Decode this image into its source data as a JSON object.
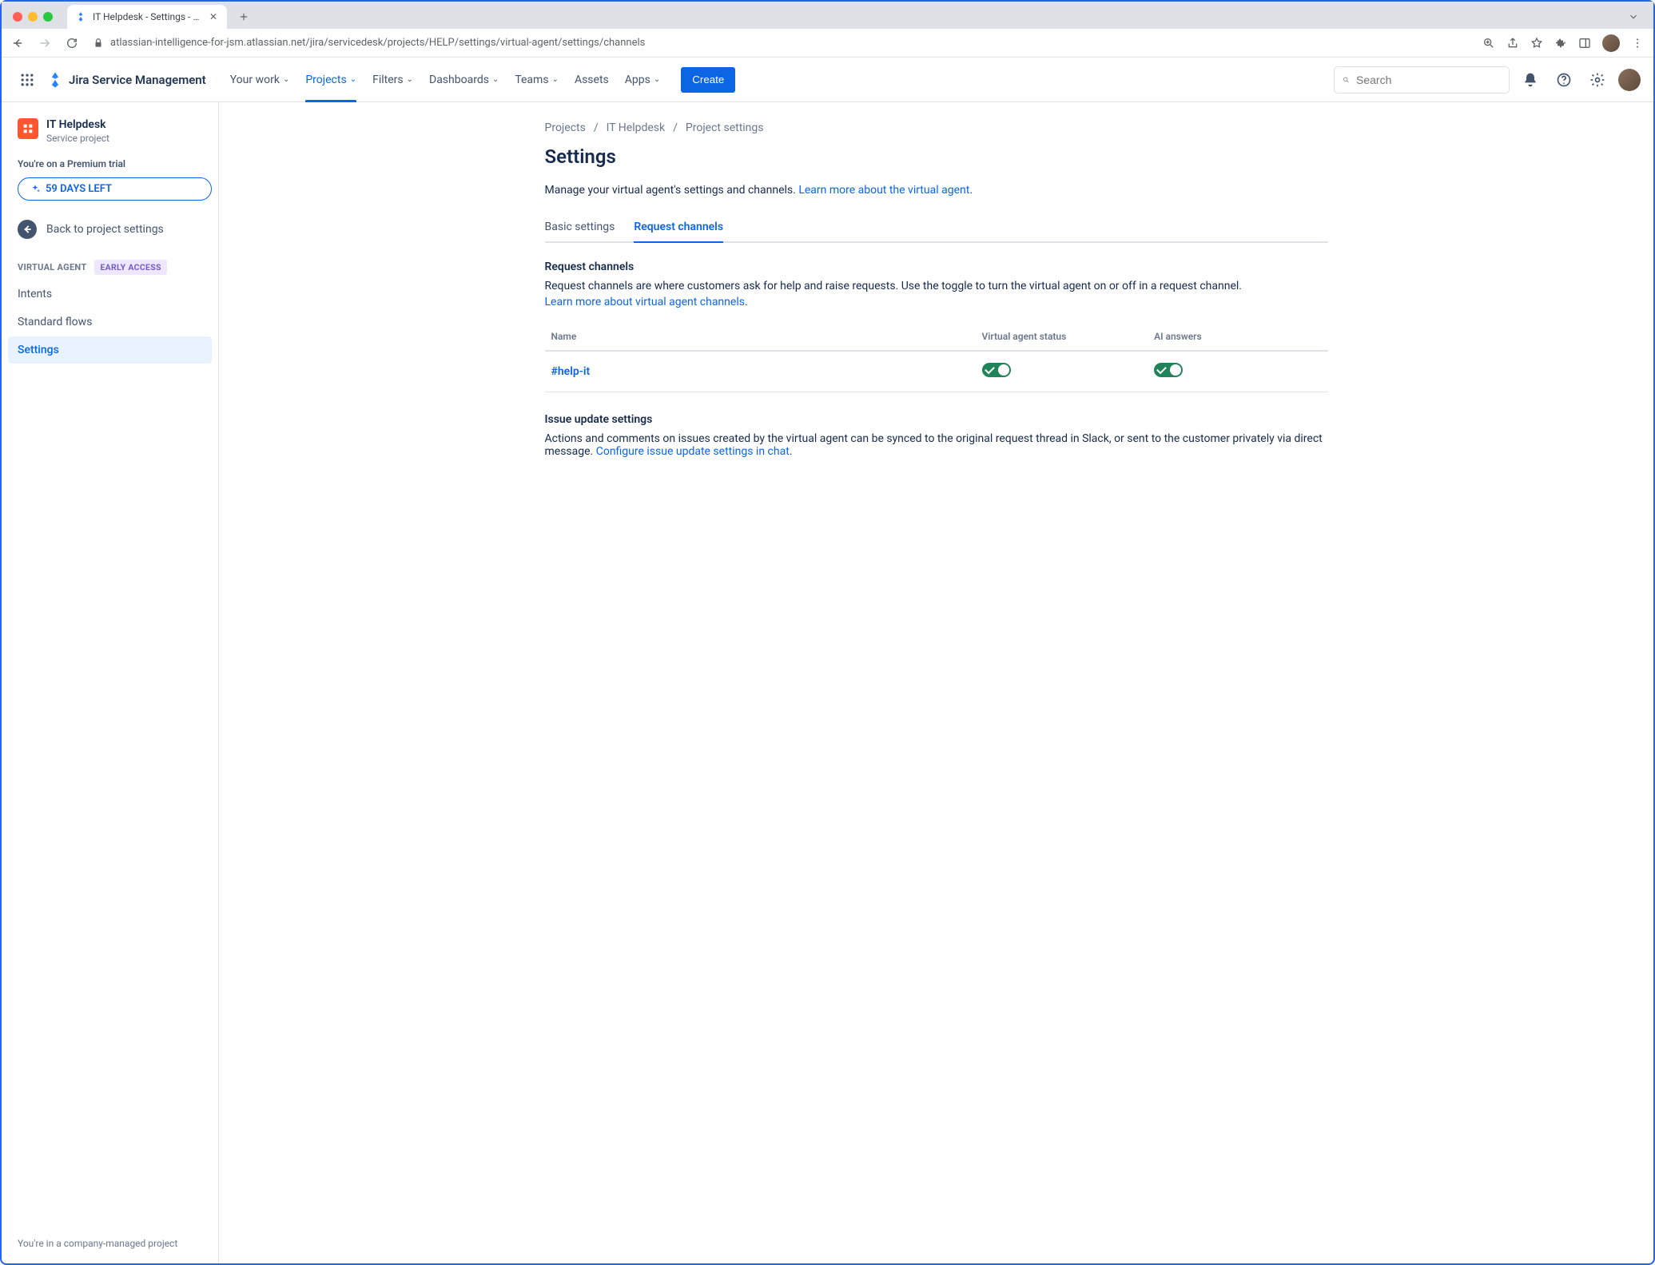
{
  "browser": {
    "tab_title": "IT Helpdesk - Settings - Servic",
    "url": "atlassian-intelligence-for-jsm.atlassian.net/jira/servicedesk/projects/HELP/settings/virtual-agent/settings/channels"
  },
  "nav": {
    "app_name": "Jira Service Management",
    "items": [
      "Your work",
      "Projects",
      "Filters",
      "Dashboards",
      "Teams",
      "Assets",
      "Apps"
    ],
    "active_index": 1,
    "create": "Create",
    "search_placeholder": "Search"
  },
  "sidebar": {
    "project_name": "IT Helpdesk",
    "project_subtitle": "Service project",
    "trial_line": "You're on a Premium trial",
    "trial_pill": "59 DAYS LEFT",
    "back_label": "Back to project settings",
    "section_label": "VIRTUAL AGENT",
    "badge": "EARLY ACCESS",
    "items": [
      "Intents",
      "Standard flows",
      "Settings"
    ],
    "selected_index": 2,
    "footer": "You're in a company-managed project"
  },
  "main": {
    "breadcrumbs": [
      "Projects",
      "IT Helpdesk",
      "Project settings"
    ],
    "title": "Settings",
    "description": "Manage your virtual agent's settings and channels. ",
    "description_link": "Learn more about the virtual agent",
    "tabs": [
      "Basic settings",
      "Request channels"
    ],
    "active_tab_index": 1,
    "request_channels": {
      "heading": "Request channels",
      "desc": "Request channels are where customers ask for help and raise requests. Use the toggle to turn the virtual agent on or off in a request channel.",
      "desc_link": "Learn more about virtual agent channels",
      "columns": [
        "Name",
        "Virtual agent status",
        "AI answers"
      ],
      "rows": [
        {
          "name": "#help-it",
          "virtual_agent_status": true,
          "ai_answers": true
        }
      ]
    },
    "issue_update": {
      "heading": "Issue update settings",
      "desc": "Actions and comments on issues created by the virtual agent can be synced to the original request thread in Slack, or sent to the customer privately via direct message. ",
      "desc_link": "Configure issue update settings in chat"
    }
  }
}
